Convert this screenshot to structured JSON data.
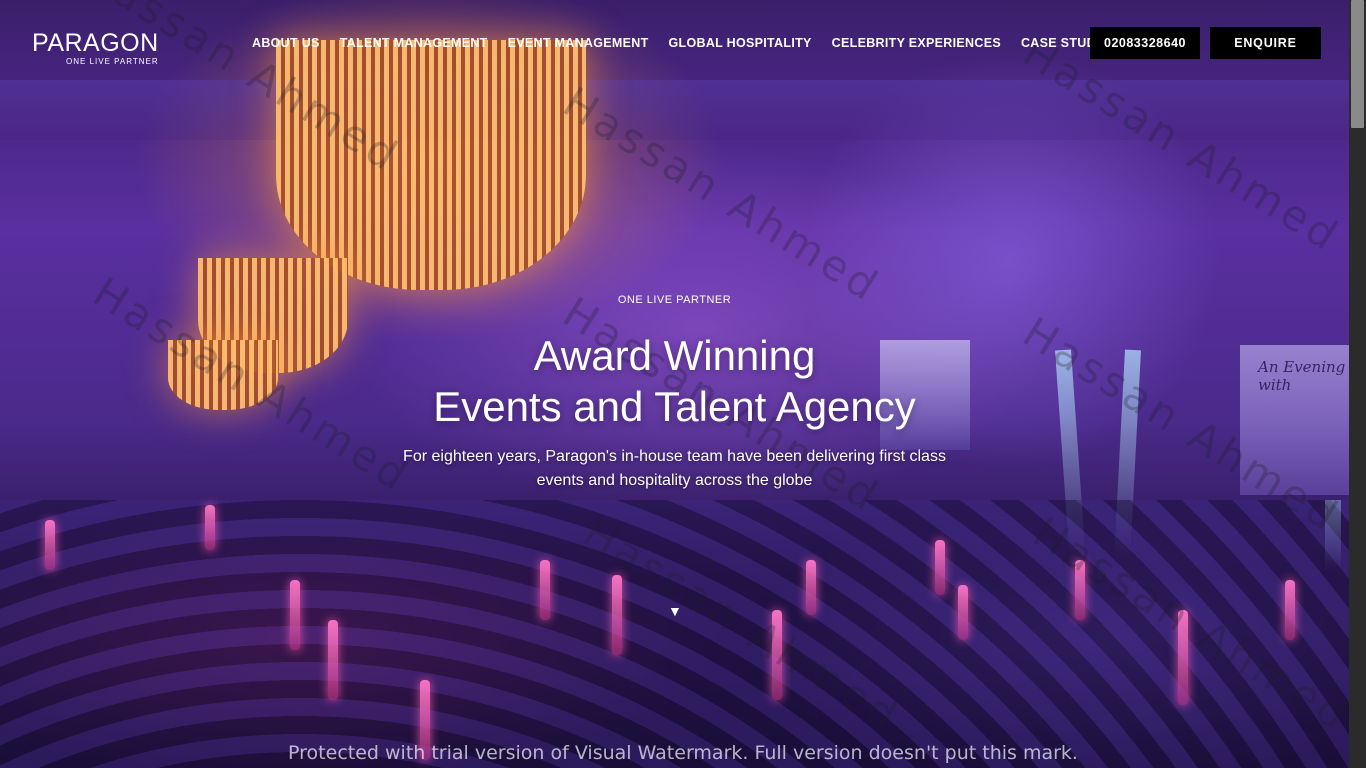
{
  "brand": {
    "name": "PARAGON",
    "tagline": "ONE LIVE PARTNER"
  },
  "nav": {
    "items": [
      {
        "label": "ABOUT US"
      },
      {
        "label": "TALENT MANAGEMENT"
      },
      {
        "label": "EVENT MANAGEMENT"
      },
      {
        "label": "GLOBAL HOSPITALITY"
      },
      {
        "label": "CELEBRITY EXPERIENCES"
      },
      {
        "label": "CASE STUDIES"
      }
    ],
    "phone": "02083328640",
    "enquire_label": "ENQUIRE"
  },
  "hero": {
    "eyebrow": "ONE LIVE PARTNER",
    "headline_line1": "Award Winning",
    "headline_line2": "Events and Talent Agency",
    "subtext": "For eighteen years, Paragon's in-house team have been delivering first class events and hospitality across the globe",
    "scroll_icon": "down-triangle-icon",
    "screen_text": "An Evening with"
  },
  "watermark": {
    "text": "Hassan Ahmed",
    "trial_notice": "Protected with trial version of Visual Watermark. Full version doesn't put this mark."
  },
  "colors": {
    "button_bg": "#000000",
    "text": "#ffffff",
    "hero_purple": "#5a2fa0"
  }
}
